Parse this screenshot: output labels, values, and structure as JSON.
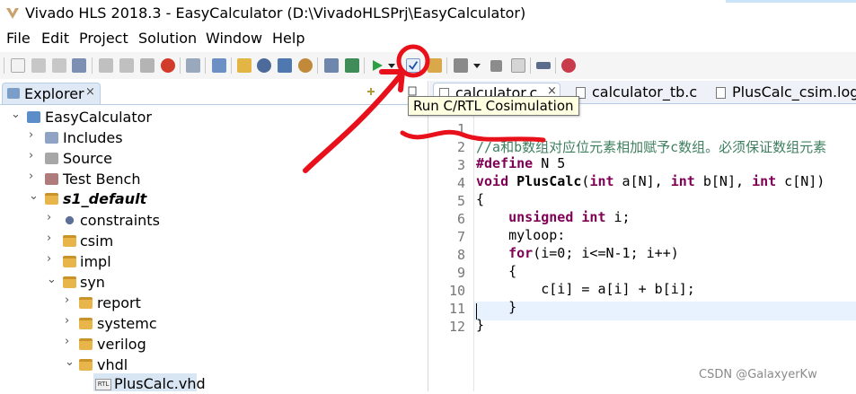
{
  "window": {
    "title": "Vivado HLS 2018.3 - EasyCalculator (D:\\VivadoHLSPrj\\EasyCalculator)",
    "logo_icon": "vivado-logo-icon"
  },
  "menu": {
    "items": [
      "File",
      "Edit",
      "Project",
      "Solution",
      "Window",
      "Help"
    ]
  },
  "toolbar": {
    "icons": [
      "new-icon",
      "save-icon",
      "save-all-icon",
      "save-as-icon",
      "cut-icon",
      "copy-icon",
      "paste-icon",
      "delete-icon",
      "print-icon",
      "open-report-icon",
      "new-solution-icon",
      "settings-icon",
      "project-settings-icon",
      "solution-settings-icon",
      "index-icon",
      "console-icon",
      "run-c-simulation-icon",
      "run-c-synthesis-icon",
      "run-cosimulation-icon",
      "export-rtl-icon",
      "open-wave-icon",
      "run-dropdown-icon",
      "stop-icon",
      "compare-icon",
      "analysis-icon",
      "debug-icon"
    ],
    "cosim_tooltip": "Run C/RTL Cosimulation"
  },
  "explorer": {
    "tab_label": "Explorer",
    "tab_close": "×",
    "tree": [
      {
        "label": "EasyCalculator",
        "icon": "project-icon",
        "expanded": true
      },
      {
        "label": "Includes",
        "icon": "includes-icon",
        "expanded": false
      },
      {
        "label": "Source",
        "icon": "source-folder-icon",
        "expanded": false
      },
      {
        "label": "Test Bench",
        "icon": "test-bench-icon",
        "expanded": false
      },
      {
        "label": "s1_default",
        "icon": "solution-icon",
        "expanded": true,
        "bold": true
      },
      {
        "label": "constraints",
        "icon": "constraints-icon",
        "expanded": false
      },
      {
        "label": "csim",
        "icon": "folder-icon",
        "expanded": false
      },
      {
        "label": "impl",
        "icon": "folder-icon",
        "expanded": false
      },
      {
        "label": "syn",
        "icon": "folder-icon",
        "expanded": true
      },
      {
        "label": "report",
        "icon": "folder-icon",
        "expanded": false
      },
      {
        "label": "systemc",
        "icon": "folder-icon",
        "expanded": false
      },
      {
        "label": "verilog",
        "icon": "folder-icon",
        "expanded": false
      },
      {
        "label": "vhdl",
        "icon": "folder-icon",
        "expanded": true
      },
      {
        "label": "PlusCalc.vhd",
        "icon": "rtl-file-icon",
        "selected": true
      }
    ]
  },
  "editor": {
    "tabs": [
      {
        "label": "calculator.c",
        "close": "×",
        "active": true
      },
      {
        "label": "calculator_tb.c",
        "active": false
      },
      {
        "label": "PlusCalc_csim.log",
        "active": false
      }
    ],
    "lines": [
      {
        "n": "1",
        "text": "//a和b数组对应位元素相加赋予c数组。必须保证数组元素"
      },
      {
        "n": "2",
        "text": "#define N 5"
      },
      {
        "n": "3",
        "text": "void PlusCalc(int a[N], int b[N], int c[N])"
      },
      {
        "n": "4",
        "text": "{"
      },
      {
        "n": "5",
        "text": "    unsigned int i;"
      },
      {
        "n": "6",
        "text": "    myloop:"
      },
      {
        "n": "7",
        "text": "    for(i=0; i<=N-1; i++)"
      },
      {
        "n": "8",
        "text": "    {"
      },
      {
        "n": "9",
        "text": "        c[i] = a[i] + b[i];"
      },
      {
        "n": "10",
        "text": "    }"
      },
      {
        "n": "11",
        "text": "}"
      },
      {
        "n": "12",
        "text": ""
      }
    ]
  },
  "annotation": {
    "color": "#e8101a"
  },
  "watermark": "CSDN @GalaxyerKw"
}
